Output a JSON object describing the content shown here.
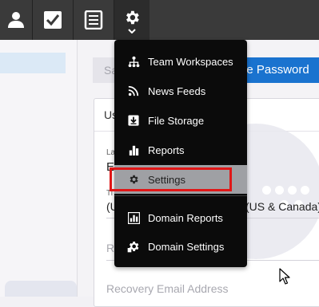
{
  "topbar": {
    "icons": [
      "user-icon",
      "checkbox-icon",
      "list-document-icon",
      "gear-icon"
    ],
    "active": "gear-icon"
  },
  "main": {
    "save_label": "Save",
    "change_password_label": "Change Password",
    "change_password_visible": "ge Password",
    "save_visible": "Sa",
    "card": {
      "title_visible": "Us",
      "label_fragment": "La",
      "value_fragment": "E",
      "tz_label_fragment": "Ti",
      "tz_value_fragment": "(U",
      "tz_value_right": "(US & Canada)",
      "r_fragment": "R",
      "recovery_email_label": "Recovery Email Address"
    }
  },
  "menu": {
    "items": [
      {
        "label": "Team Workspaces",
        "icon": "team-hierarchy-icon"
      },
      {
        "label": "News Feeds",
        "icon": "rss-icon"
      },
      {
        "label": "File Storage",
        "icon": "file-download-icon"
      },
      {
        "label": "Reports",
        "icon": "bar-chart-icon"
      },
      {
        "label": "Settings",
        "icon": "gear-icon",
        "selected": true
      },
      {
        "label": "Domain Reports",
        "icon": "domain-report-icon"
      },
      {
        "label": "Domain Settings",
        "icon": "domain-settings-icon"
      }
    ]
  },
  "colors": {
    "topbar": "#3a3a3a",
    "menu_bg": "#0b0b0b",
    "menu_selected": "#9fa0a4",
    "highlight": "#e01717",
    "primary_button": "#1a73cf"
  }
}
